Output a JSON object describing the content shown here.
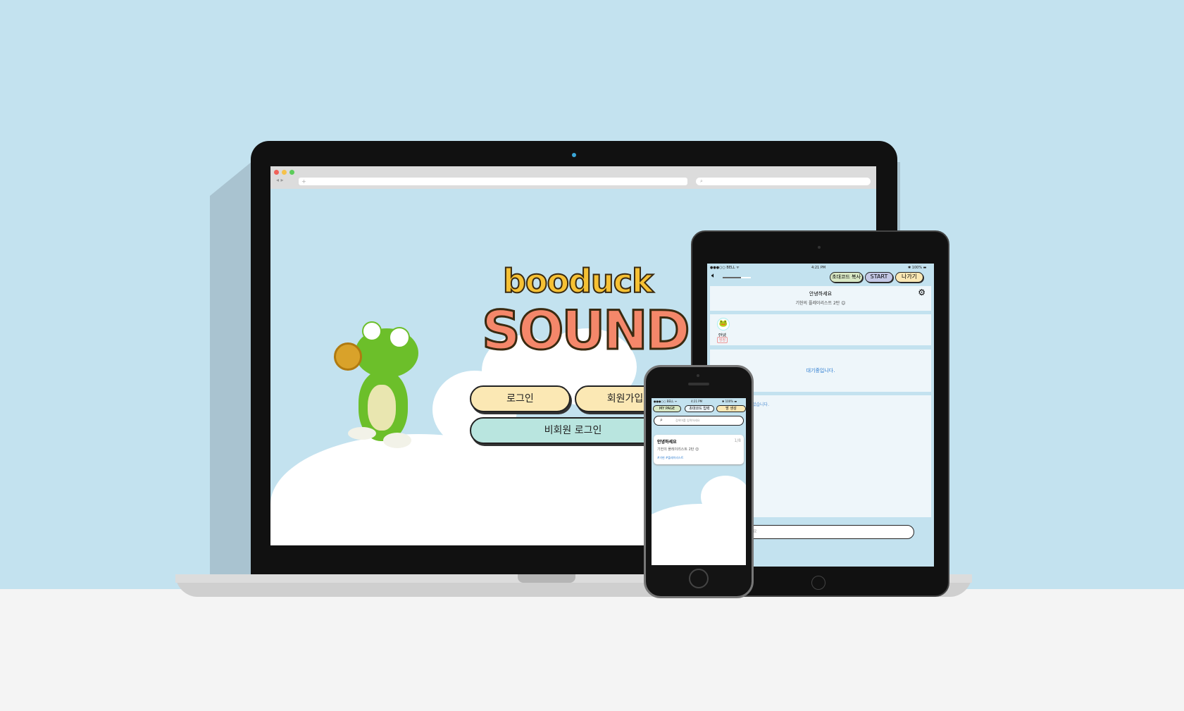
{
  "browser": {
    "url_placeholder": "+",
    "search_placeholder": "⌕"
  },
  "laptop": {
    "logo_top": "booduck",
    "logo_bottom": "SOUND",
    "login": "로그인",
    "signup": "회원가입",
    "guest_login": "비회원 로그인"
  },
  "tablet": {
    "status_left": "●●●○○ BELL ᯤ",
    "status_time": "4:21 PM",
    "status_right": "✱ 100% ▬",
    "invite_copy": "초대코드 복사",
    "start": "START",
    "exit": "나가기",
    "room_title": "안녕하세요",
    "room_subtitle": "기헌의 플레이리스트 2탄 😊",
    "member_name": "안녕",
    "member_role": "방장",
    "waiting": "대기중입니다.",
    "chat_notice": "었습니다.",
    "chat_input": "요"
  },
  "phone": {
    "status_left": "●●●○○ BELL ᯤ",
    "status_time": "4:21 PM",
    "status_right": "✱ 100% ▬",
    "my_page": "MY PAGE",
    "invite_enter": "초대코드 입력",
    "create_room": "방 생성",
    "search_placeholder": "검색어를 입력하세요",
    "card_title": "안녕하세요",
    "card_count": "1/8",
    "card_subtitle": "기헌의 플레이리스트 2탄 😊",
    "card_tags": "#기헌 #플레이리스트"
  }
}
